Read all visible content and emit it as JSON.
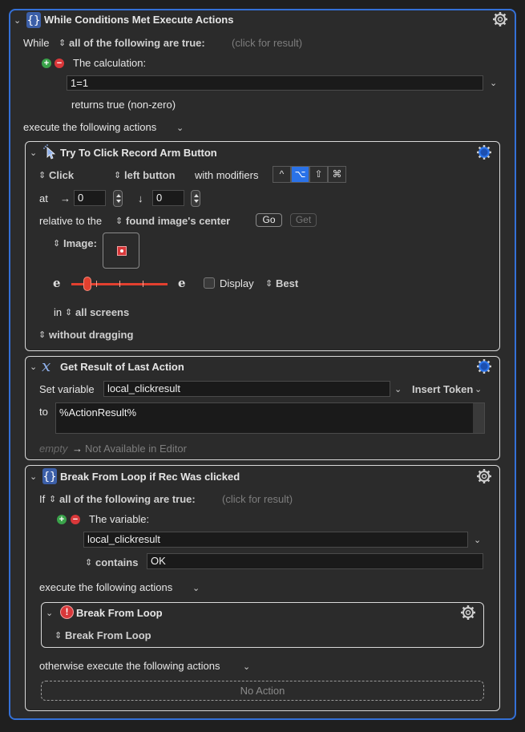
{
  "colors": {
    "accent": "#3470d6",
    "panel": "#2b2b2b",
    "active_modifier": "#2a72e8",
    "slider": "#e2402f",
    "pixel": "#d9383a"
  },
  "outer": {
    "title": "While Conditions Met Execute Actions",
    "while_label": "While",
    "condition_mode": "all of the following are true:",
    "click_result": "(click for result)",
    "calc_label": "The calculation:",
    "calc_value": "1=1",
    "returns_label": "returns true (non-zero)",
    "execute_label": "execute the following actions"
  },
  "click_action": {
    "title": "Try To Click Record Arm Button",
    "click_type": "Click",
    "button": "left button",
    "modifiers_label": "with modifiers",
    "modifiers": [
      "^",
      "⌥",
      "⇧",
      "⌘"
    ],
    "at_label": "at",
    "x_arrow": "→",
    "x_value": "0",
    "y_arrow": "↓",
    "y_value": "0",
    "relative_label": "relative to the",
    "relative_target": "found image's center",
    "go_label": "Go",
    "get_label": "Get",
    "image_label": "Image:",
    "fuzz_left": "e",
    "fuzz_right": "e",
    "display_label": "Display",
    "best_label": "Best",
    "in_label": "in",
    "screens": "all screens",
    "drag_option": "without dragging"
  },
  "result_action": {
    "title": "Get Result of Last Action",
    "set_var_label": "Set variable",
    "var_name": "local_clickresult",
    "insert_token": "Insert Token",
    "to_label": "to",
    "to_value": "%ActionResult%",
    "empty_label": "empty",
    "arrow": "→",
    "preview": "Not Available in Editor"
  },
  "break_if": {
    "title": "Break From Loop if Rec Was clicked",
    "if_label": "If",
    "condition_mode": "all of the following are true:",
    "click_result": "(click for result)",
    "var_label": "The variable:",
    "var_name": "local_clickresult",
    "operator": "contains",
    "compare_value": "OK",
    "execute_label": "execute the following actions",
    "otherwise_label": "otherwise execute the following actions",
    "no_action": "No Action"
  },
  "break_action": {
    "title": "Break From Loop",
    "option": "Break From Loop"
  }
}
